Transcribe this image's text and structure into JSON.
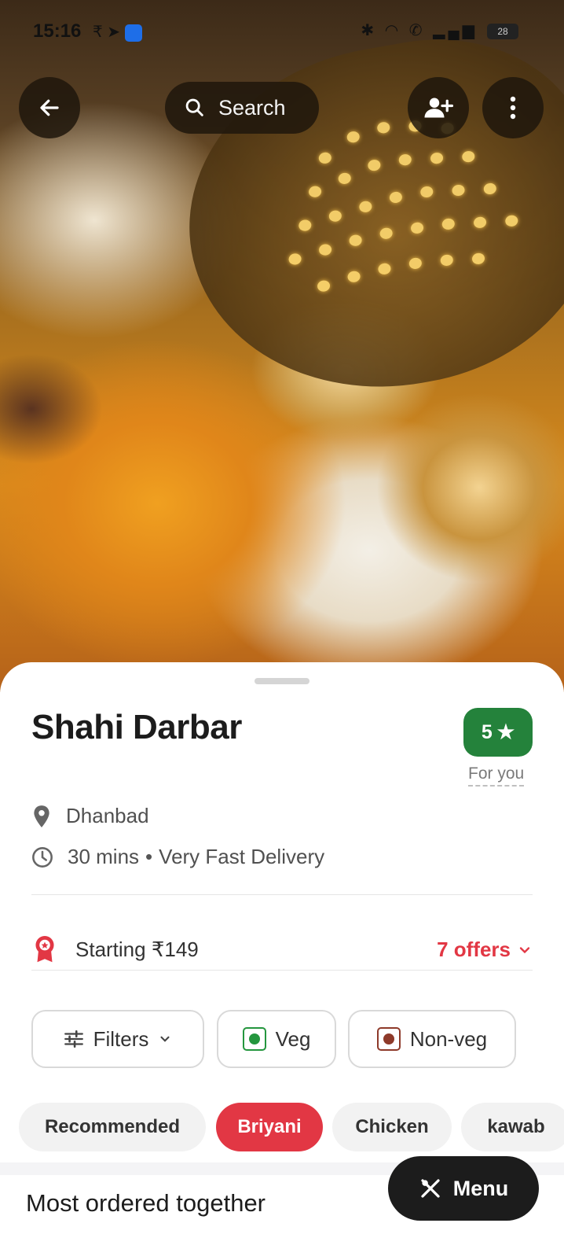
{
  "status_bar": {
    "time": "15:16",
    "left_icons": [
      "rupee-icon",
      "telegram-icon",
      "app-icon"
    ],
    "right_icons": [
      "bluetooth-icon",
      "wifi-icon",
      "call-icon",
      "signal-icon"
    ],
    "battery": "28"
  },
  "header": {
    "search_label": "Search"
  },
  "restaurant": {
    "name": "Shahi Darbar",
    "rating": "5",
    "rating_caption": "For you",
    "location": "Dhanbad",
    "delivery_time": "30 mins",
    "delivery_note": "Very Fast Delivery",
    "starting_price": "Starting ₹149",
    "offers": "7 offers"
  },
  "filters": {
    "filters_label": "Filters",
    "veg_label": "Veg",
    "nonveg_label": "Non-veg"
  },
  "categories": [
    "Recommended",
    "Briyani",
    "Chicken",
    "kawab"
  ],
  "active_category": "Briyani",
  "section": {
    "title": "Most ordered together"
  },
  "fab": {
    "label": "Menu"
  },
  "colors": {
    "brand_red": "#e23744",
    "rating_green": "#24823b",
    "dark": "#1c1c1c"
  }
}
